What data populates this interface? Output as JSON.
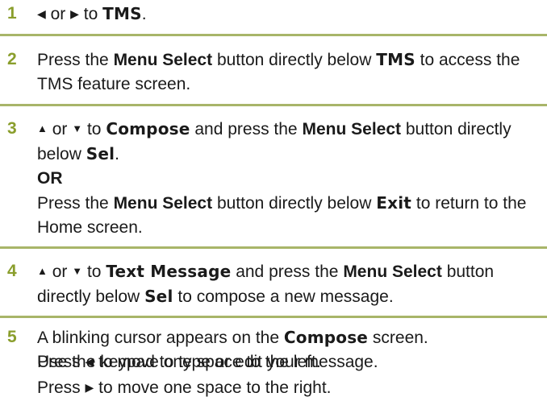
{
  "colors": {
    "step_number": "#8a9e2c",
    "rule": "#a8b569",
    "text": "#1a1a1a"
  },
  "icons": {
    "left": "arrow-left-icon",
    "right": "arrow-right-icon",
    "up": "arrow-up-icon",
    "down": "arrow-down-icon"
  },
  "glyphs": {
    "left": "◀",
    "right": "▶",
    "up": "▲",
    "down": "▼"
  },
  "steps": [
    {
      "number": "1",
      "t1": "or",
      "t2": "to",
      "d1": "TMS",
      "t3": "."
    },
    {
      "number": "2",
      "t1": "Press the",
      "b1": "Menu Select",
      "t2": "button directly below",
      "d1": "TMS",
      "t3": "to access the TMS feature screen."
    },
    {
      "number": "3",
      "t1": "or",
      "t2": "to",
      "d1": "Compose",
      "t3": "and press the",
      "b1": "Menu Select",
      "t4": "button directly below",
      "d2": "Sel",
      "t5": ".",
      "or": "OR",
      "t6": "Press the",
      "b2": "Menu Select",
      "t7": "button directly below",
      "d3": "Exit",
      "t8": "to return to the Home screen."
    },
    {
      "number": "4",
      "t1": "or",
      "t2": "to",
      "d1": "Text Message",
      "t3": "and press the",
      "b1": "Menu Select",
      "t4": "button directly below",
      "d2": "Sel",
      "t5": "to compose a new message."
    },
    {
      "number": "5",
      "t1": "A blinking cursor appears on the",
      "d1": "Compose",
      "t2": "screen.",
      "line2": "Use the keypad to type or edit your message.",
      "l3a": "Press",
      "l3b": "to move one space to the left.",
      "l4a": "Press",
      "l4b": "to move one space to the right."
    }
  ]
}
